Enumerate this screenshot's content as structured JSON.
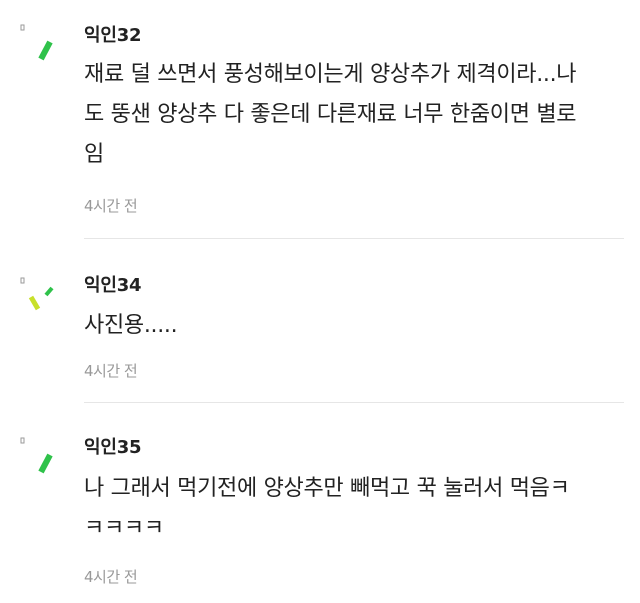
{
  "comments": [
    {
      "author": "익인32",
      "text": "재료 덜 쓰면서 풍성해보이는게 양상추가 제격이라...나\n도 뚱샌 양상추 다 좋은데 다른재료 너무 한줌이면 별로\n임",
      "time": "4시간 전",
      "avatar_icon": "green-slash-icon",
      "avatar_colors": [
        "#2fc24a"
      ]
    },
    {
      "author": "익인34",
      "text": "사진용.....",
      "time": "4시간 전",
      "avatar_icon": "green-yellow-slashes-icon",
      "avatar_colors": [
        "#2fc24a",
        "#c8e02a"
      ]
    },
    {
      "author": "익인35",
      "text": "나 그래서 먹기전에 양상추만 빼먹고 꾹 눌러서 먹음ㅋ\nㅋㅋㅋㅋ",
      "time": "4시간 전",
      "avatar_icon": "green-slash-icon",
      "avatar_colors": [
        "#2fc24a"
      ]
    }
  ],
  "colors": {
    "text": "#222222",
    "time": "#999999",
    "divider": "#e6e6e6",
    "avatar_dot": "#9a9a9a"
  }
}
